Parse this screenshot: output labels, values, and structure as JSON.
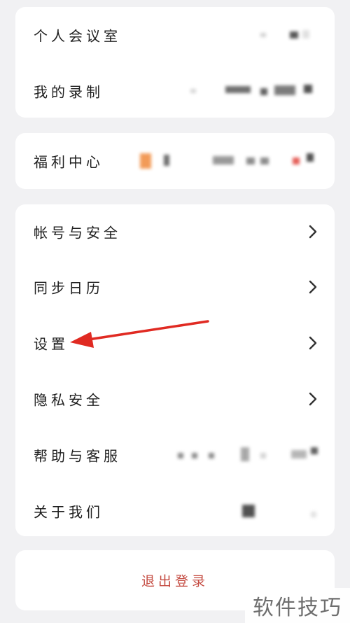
{
  "section_top": {
    "items": [
      {
        "label": "个人会议室"
      },
      {
        "label": "我的录制"
      }
    ]
  },
  "section_welfare": {
    "items": [
      {
        "label": "福利中心"
      }
    ]
  },
  "section_main": {
    "items": [
      {
        "label": "帐号与安全",
        "icon": "chevron-right-icon"
      },
      {
        "label": "同步日历",
        "icon": "chevron-right-icon"
      },
      {
        "label": "设置",
        "icon": "chevron-right-icon"
      },
      {
        "label": "隐私安全",
        "icon": "chevron-right-icon"
      },
      {
        "label": "帮助与客服"
      },
      {
        "label": "关于我们"
      }
    ]
  },
  "logout": {
    "label": "退出登录"
  },
  "annotation": {
    "arrow_color": "#e02a22",
    "arrow_target": "设置"
  },
  "watermark": {
    "text": "软件技巧"
  },
  "colors": {
    "background": "#f1f1f3",
    "card": "#ffffff",
    "logout_text": "#c44a40",
    "chevron": "#333333"
  }
}
